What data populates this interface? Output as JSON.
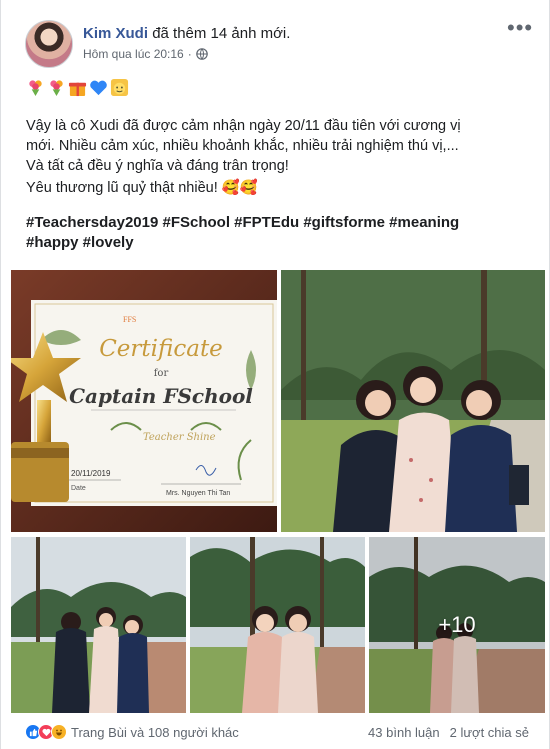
{
  "post": {
    "author": "Kim Xudi",
    "action": "đã thêm 14 ảnh mới.",
    "timestamp": "Hôm qua lúc 20:16",
    "separator": "·",
    "privacy_icon": "globe-icon",
    "more_icon": "more-horizontal-icon",
    "more_label": "•••",
    "emojis": [
      "bouquet",
      "bouquet",
      "gift",
      "blue-heart",
      "teacher-face"
    ],
    "paragraph1": [
      "Vậy là cô Xudi đã được cảm nhận ngày 20/11 đầu tiên với cương vị",
      "mới. Nhiều cảm xúc, nhiều khoảnh khắc, nhiều trải nghiệm thú vị,...",
      "Và tất cả đều ý nghĩa và đáng trân trọng!"
    ],
    "paragraph2": "Yêu thương lũ quỷ thật nhiều! 🥰🥰",
    "hashtags_line1": "#Teachersday2019 #FSchool #FPTEdu #giftsforme #meaning",
    "hashtags_line2": "#happy #lovely",
    "more_photos_label": "+10"
  },
  "certificate": {
    "logo_text": "FFS",
    "title": "Certificate",
    "for": "for",
    "name": "Captain FSchool",
    "subtitle": "Teacher Shine",
    "date_value": "20/11/2019",
    "date_label": "Date",
    "signer": "Mrs. Nguyen Thi Tan"
  },
  "footer": {
    "reaction_icons": [
      "like-icon",
      "love-icon",
      "haha-icon"
    ],
    "reactors": "Trang Bùi và 108 người khác",
    "comments": "43 bình luận",
    "shares": "2 lượt chia sẻ"
  }
}
